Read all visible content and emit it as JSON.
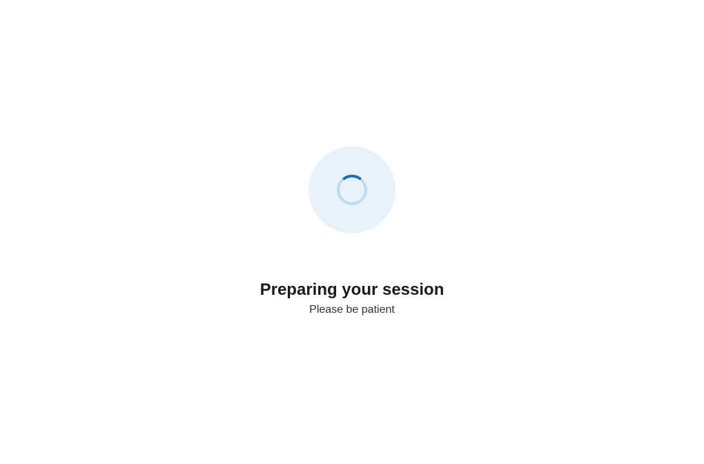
{
  "loading": {
    "heading": "Preparing your session",
    "subtext": "Please be patient"
  },
  "colors": {
    "spinner_bg": "#e9f1f9",
    "spinner_track": "#bfd9ed",
    "spinner_arc": "#1a6fc4"
  }
}
